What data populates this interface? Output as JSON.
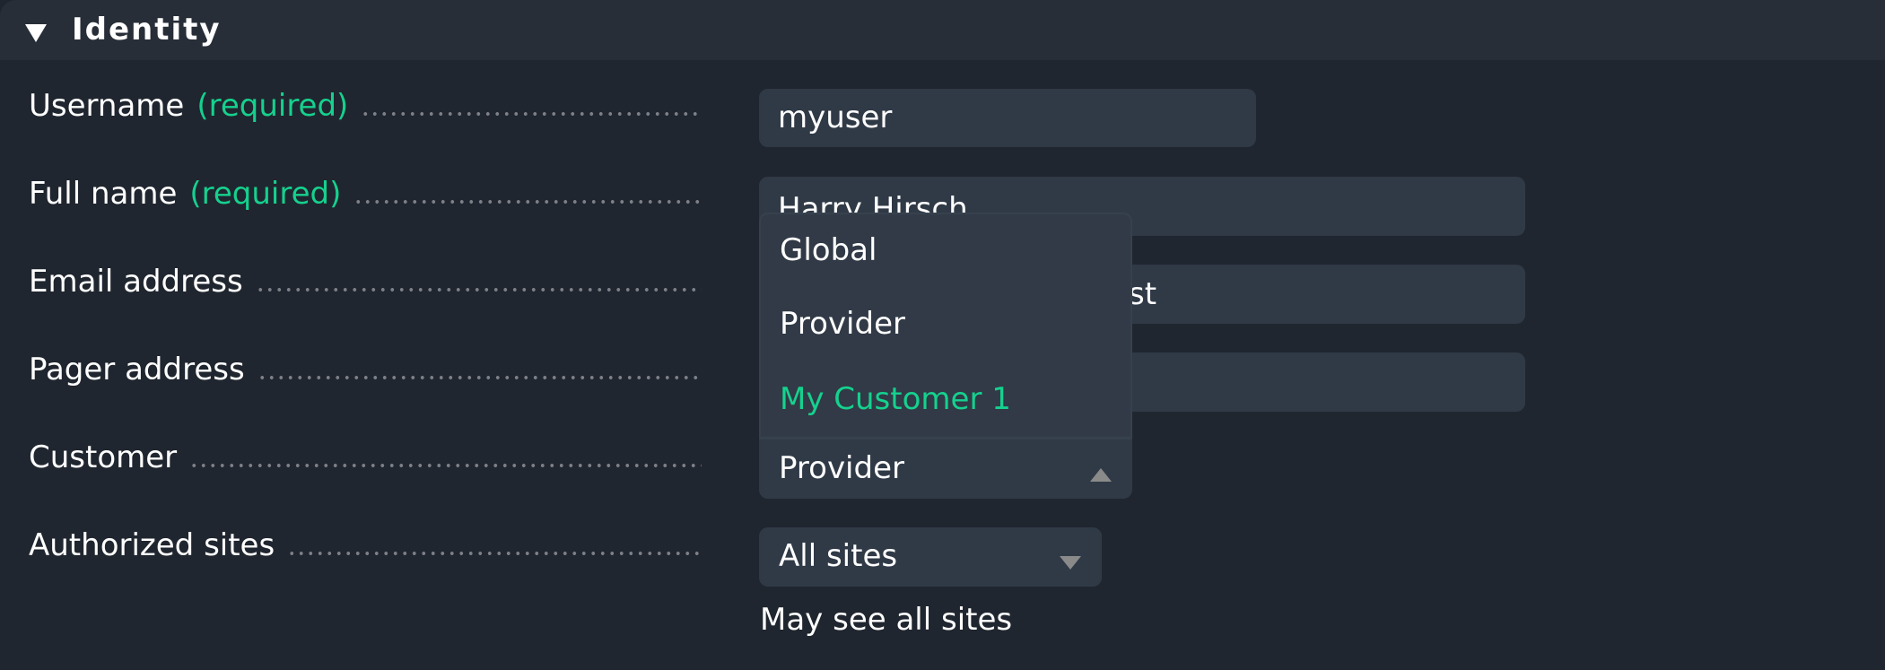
{
  "section": {
    "title": "Identity",
    "collapse_icon": "triangle-down-icon",
    "expanded": true
  },
  "colors": {
    "background": "#20262f",
    "header_background": "#272e38",
    "input_background": "#303a47",
    "accent_green": "#15d18e",
    "leader_dots": "#7d8087",
    "select_arrow": "#8a8a8a"
  },
  "required_marker": "(required)",
  "fields": {
    "username": {
      "label": "Username",
      "required": true,
      "value": "myuser"
    },
    "full_name": {
      "label": "Full name",
      "required": true,
      "value": "Harry Hirsch"
    },
    "email": {
      "label": "Email address",
      "required": false,
      "visible_value_fragment": "st"
    },
    "pager": {
      "label": "Pager address",
      "required": false,
      "value": ""
    },
    "customer": {
      "label": "Customer",
      "required": false,
      "selected": "Provider",
      "open": true,
      "arrow_icon": "triangle-up-icon",
      "options": [
        {
          "label": "Global",
          "highlighted": false
        },
        {
          "label": "Provider",
          "highlighted": false
        },
        {
          "label": "My Customer 1",
          "highlighted": true
        }
      ]
    },
    "authorized_sites": {
      "label": "Authorized sites",
      "required": false,
      "selected": "All sites",
      "arrow_icon": "triangle-down-icon",
      "help_text": "May see all sites"
    }
  }
}
